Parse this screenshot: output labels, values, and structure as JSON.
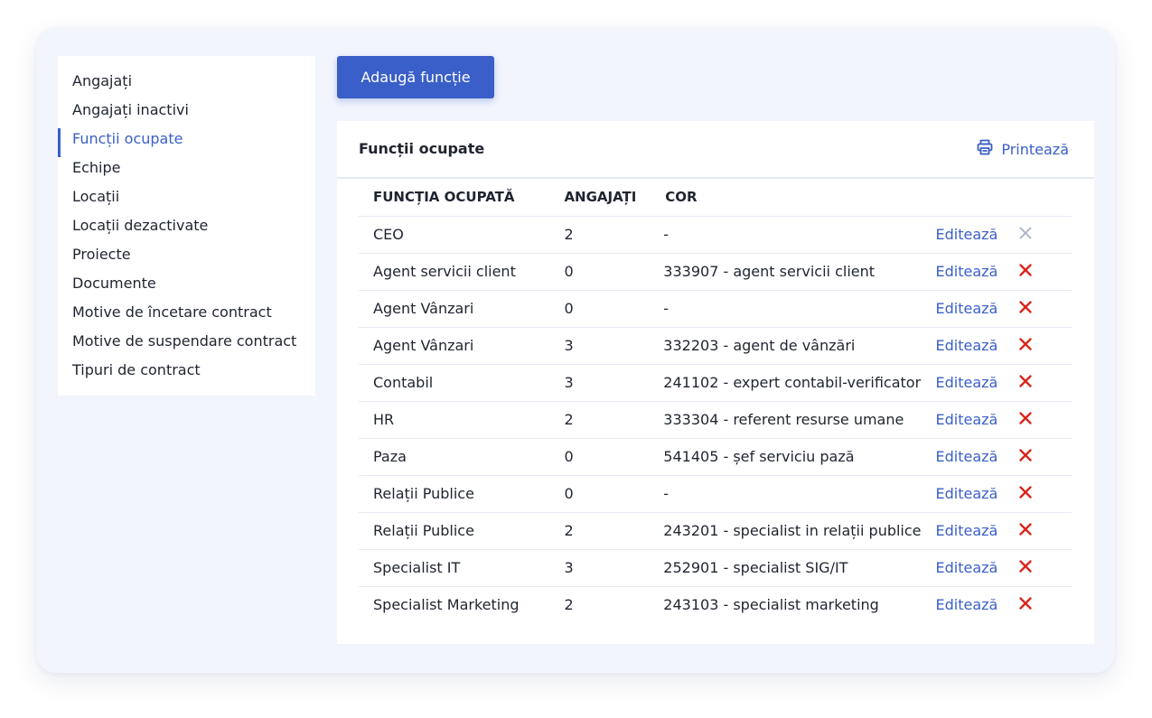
{
  "sidebar": {
    "items": [
      {
        "label": "Angajați"
      },
      {
        "label": "Angajați inactivi"
      },
      {
        "label": "Funcții ocupate"
      },
      {
        "label": "Echipe"
      },
      {
        "label": "Locații"
      },
      {
        "label": "Locații dezactivate"
      },
      {
        "label": "Proiecte"
      },
      {
        "label": "Documente"
      },
      {
        "label": "Motive de încetare contract"
      },
      {
        "label": "Motive de suspendare contract"
      },
      {
        "label": "Tipuri de contract"
      }
    ],
    "active_index": 2
  },
  "toolbar": {
    "add_label": "Adaugă funcție"
  },
  "panel": {
    "title": "Funcții ocupate",
    "print_label": "Printează",
    "print_icon": "printer-icon"
  },
  "table": {
    "headers": {
      "function": "FUNCȚIA OCUPATĂ",
      "employees": "ANGAJAȚI",
      "cor": "COR"
    },
    "edit_label": "Editează",
    "rows": [
      {
        "function": "CEO",
        "employees": "2",
        "cor": "-",
        "delete_enabled": false
      },
      {
        "function": "Agent servicii client",
        "employees": "0",
        "cor": "333907 - agent servicii client",
        "delete_enabled": true
      },
      {
        "function": "Agent Vânzari",
        "employees": "0",
        "cor": "-",
        "delete_enabled": true
      },
      {
        "function": "Agent Vânzari",
        "employees": "3",
        "cor": "332203 - agent de vânzări",
        "delete_enabled": true
      },
      {
        "function": "Contabil",
        "employees": "3",
        "cor": "241102 - expert contabil-verificator",
        "delete_enabled": true
      },
      {
        "function": "HR",
        "employees": "2",
        "cor": "333304 - referent resurse umane",
        "delete_enabled": true
      },
      {
        "function": "Paza",
        "employees": "0",
        "cor": "541405 - șef serviciu pază",
        "delete_enabled": true
      },
      {
        "function": "Relații Publice",
        "employees": "0",
        "cor": "-",
        "delete_enabled": true
      },
      {
        "function": "Relații Publice",
        "employees": "2",
        "cor": "243201 - specialist in relații publice",
        "delete_enabled": true
      },
      {
        "function": "Specialist IT",
        "employees": "3",
        "cor": "252901 - specialist SIG/IT",
        "delete_enabled": true
      },
      {
        "function": "Specialist Marketing",
        "employees": "2",
        "cor": "243103 - specialist marketing",
        "delete_enabled": true
      }
    ]
  },
  "colors": {
    "accent": "#3a5fc8",
    "delete_active": "#d9261c",
    "delete_disabled": "#a9b3c4",
    "frame_bg": "#f2f5fc"
  }
}
